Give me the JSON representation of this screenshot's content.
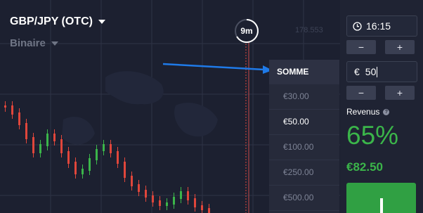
{
  "asset": {
    "name": "GBP/JPY (OTC)",
    "option_type": "Binaire"
  },
  "chart": {
    "price_label": "178.553",
    "timer": "9m"
  },
  "amount_dropdown": {
    "header": "SOMME",
    "options": [
      "€30.00",
      "€50.00",
      "€100.00",
      "€250.00",
      "€500.00"
    ],
    "selected": "€50.00"
  },
  "trade_panel": {
    "time": "16:15",
    "amount_currency": "€",
    "amount": "50",
    "minus": "−",
    "plus": "+",
    "revenue_label": "Revenus",
    "revenue_help": "?",
    "revenue_percent": "65%",
    "revenue_value": "€82.50"
  },
  "colors": {
    "accent_green": "#3bb54a",
    "annotation_arrow": "#1f7ae8",
    "candle_up": "#3bb54a",
    "candle_down": "#e0463b"
  },
  "icons": [
    "chevron-down-icon",
    "clock-icon",
    "help-icon",
    "arrow-annotation-icon"
  ]
}
